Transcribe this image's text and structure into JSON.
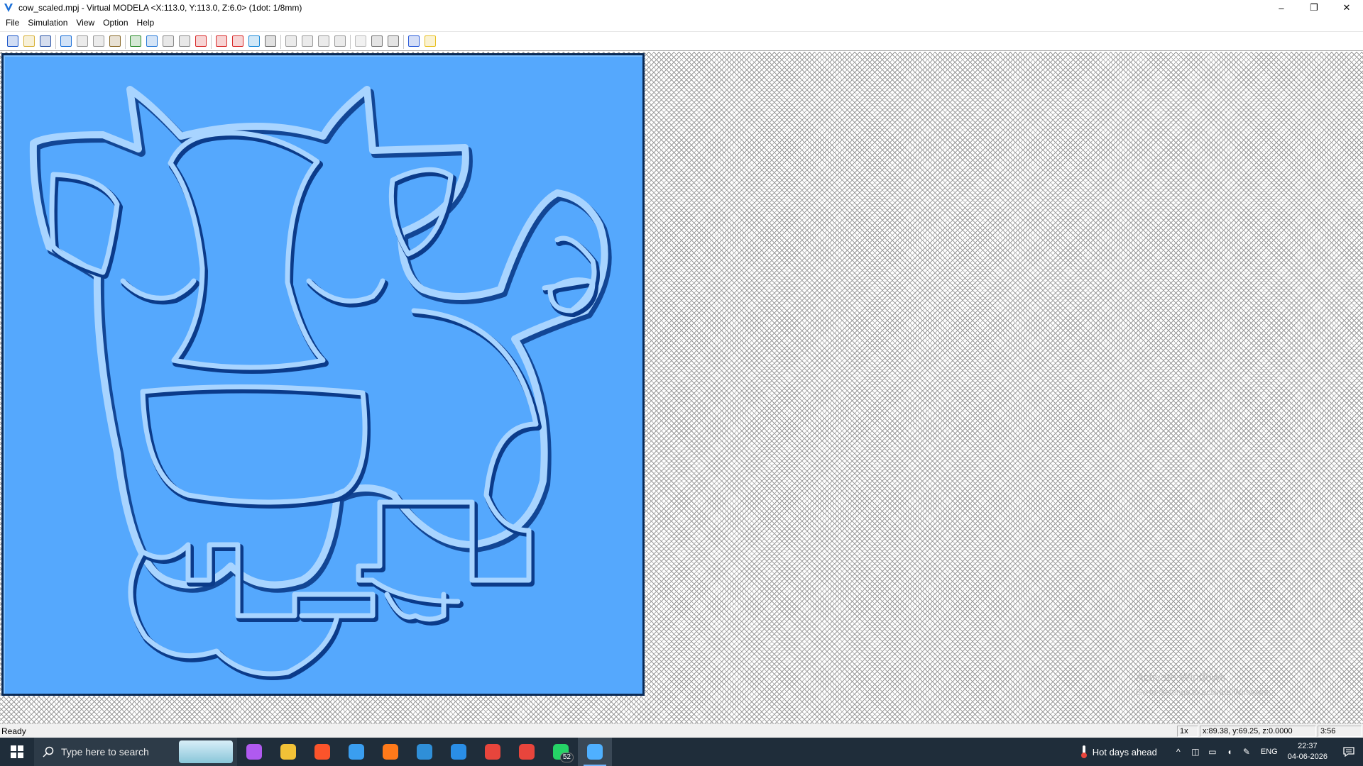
{
  "window": {
    "title": "cow_scaled.mpj - Virtual MODELA <X:113.0, Y:113.0, Z:6.0> (1dot: 1/8mm)",
    "minimize": "–",
    "restore": "❐",
    "close": "✕"
  },
  "menu": [
    "File",
    "Simulation",
    "View",
    "Option",
    "Help"
  ],
  "toolbar": [
    {
      "icon": "new-file-icon",
      "color": "#1a55c8"
    },
    {
      "icon": "open-folder-icon",
      "color": "#d8b23a"
    },
    {
      "icon": "save-icon",
      "color": "#2b55a8"
    },
    {
      "sep": true
    },
    {
      "icon": "rotate-icon",
      "color": "#1a6fd8"
    },
    {
      "icon": "stop-icon",
      "color": "#9a9a9a"
    },
    {
      "icon": "play-icon",
      "color": "#9a9a9a"
    },
    {
      "icon": "mill-icon",
      "color": "#8a6a2a"
    },
    {
      "sep": true
    },
    {
      "icon": "material-icon",
      "color": "#2a8a2a"
    },
    {
      "icon": "tool-icon",
      "color": "#2a7ad8"
    },
    {
      "icon": "path-icon",
      "color": "#8a8a8a"
    },
    {
      "icon": "curve-icon",
      "color": "#8a8a8a"
    },
    {
      "icon": "view-3d-icon",
      "color": "#d82a2a"
    },
    {
      "sep": true
    },
    {
      "icon": "section-icon",
      "color": "#d82a2a"
    },
    {
      "icon": "color-icon",
      "color": "#d82a2a"
    },
    {
      "icon": "texture-icon",
      "color": "#1a8ad8"
    },
    {
      "icon": "sphere-icon",
      "color": "#6a6a6a"
    },
    {
      "sep": true
    },
    {
      "icon": "zoom-in-icon",
      "color": "#9a9a9a"
    },
    {
      "icon": "zoom-out-icon",
      "color": "#9a9a9a"
    },
    {
      "icon": "zoom-fit-icon",
      "color": "#9a9a9a"
    },
    {
      "icon": "zoom-window-icon",
      "color": "#9a9a9a"
    },
    {
      "sep": true
    },
    {
      "icon": "light-1-icon",
      "color": "#bbbbbb"
    },
    {
      "icon": "light-2-icon",
      "color": "#777777"
    },
    {
      "icon": "light-3-icon",
      "color": "#777777"
    },
    {
      "sep": true
    },
    {
      "icon": "settings-icon",
      "color": "#2a5ad8"
    },
    {
      "icon": "sun-icon",
      "color": "#e8c020"
    }
  ],
  "render": {
    "background": "#55a8fd",
    "watermark": [
      "Activate Windows",
      "Go to Settings to activate Windows."
    ]
  },
  "status": {
    "ready": "Ready",
    "scale": "1x",
    "coords": "x:89.38, y:69.25, z:0.0000",
    "time": "3:56"
  },
  "taskbar": {
    "search_placeholder": "Type here to search",
    "apps": [
      {
        "icon": "copilot-icon",
        "color": "#b05af0"
      },
      {
        "icon": "file-explorer-icon",
        "color": "#f2c237"
      },
      {
        "icon": "brave-icon",
        "color": "#fb542b"
      },
      {
        "icon": "store-icon",
        "color": "#3a9ef0"
      },
      {
        "icon": "search-app-icon",
        "color": "#ff7a1a"
      },
      {
        "icon": "photos-icon",
        "color": "#2f8fd8"
      },
      {
        "icon": "vscode-icon",
        "color": "#2a8ee6"
      },
      {
        "icon": "chrome-icon",
        "color": "#e8453c"
      },
      {
        "icon": "chrome-profile-icon",
        "color": "#e8453c"
      },
      {
        "icon": "whatsapp-icon",
        "color": "#25d366",
        "badge": "52"
      },
      {
        "icon": "virtual-modela-icon",
        "color": "#4fb0ff",
        "active": true
      }
    ],
    "weather": "Hot days ahead",
    "language": "ENG",
    "time": "22:37",
    "date": "04-06-2026"
  }
}
